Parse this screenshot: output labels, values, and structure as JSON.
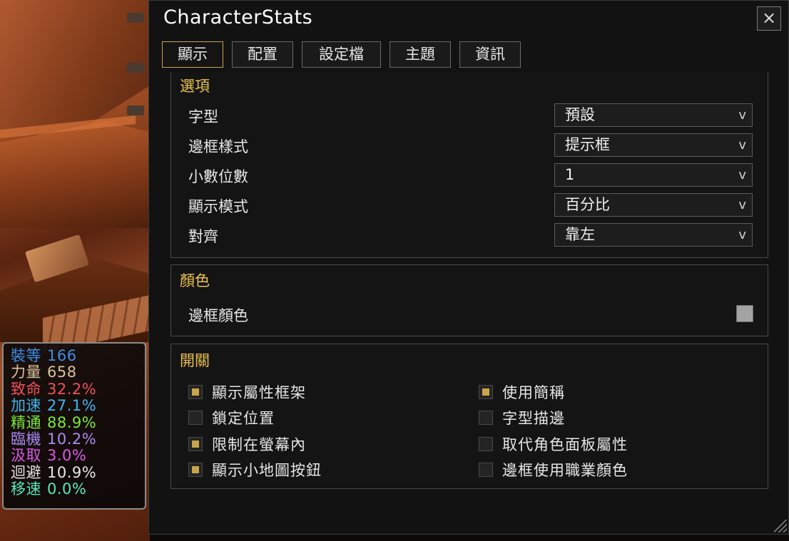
{
  "stats_overlay": [
    {
      "label": "裝等",
      "value": "166",
      "color": "#3a8ee8"
    },
    {
      "label": "力量",
      "value": "658",
      "color": "#d9c39a"
    },
    {
      "label": "致命",
      "value": "32.2%",
      "color": "#f0505a"
    },
    {
      "label": "加速",
      "value": "27.1%",
      "color": "#3ab8f0"
    },
    {
      "label": "精通",
      "value": "88.9%",
      "color": "#7ae83a"
    },
    {
      "label": "臨機",
      "value": "10.2%",
      "color": "#a88af0"
    },
    {
      "label": "汲取",
      "value": "3.0%",
      "color": "#d85ae8"
    },
    {
      "label": "迴避",
      "value": "10.9%",
      "color": "#e6e6e6"
    },
    {
      "label": "移速",
      "value": "0.0%",
      "color": "#5ae8b8"
    }
  ],
  "window": {
    "title": "CharacterStats",
    "close_label": "×",
    "tabs": [
      {
        "label": "顯示",
        "active": true
      },
      {
        "label": "配置",
        "active": false
      },
      {
        "label": "設定檔",
        "active": false
      },
      {
        "label": "主題",
        "active": false
      },
      {
        "label": "資訊",
        "active": false
      }
    ]
  },
  "options_section": {
    "title": "選項",
    "rows": [
      {
        "label": "字型",
        "value": "預設"
      },
      {
        "label": "邊框樣式",
        "value": "提示框"
      },
      {
        "label": "小數位數",
        "value": "1"
      },
      {
        "label": "顯示模式",
        "value": "百分比"
      },
      {
        "label": "對齊",
        "value": "靠左"
      }
    ],
    "dropdown_arrow": "v"
  },
  "color_section": {
    "title": "顏色",
    "border_color_label": "邊框顏色",
    "border_color": "#a3a3a3"
  },
  "toggles_section": {
    "title": "開關",
    "left": [
      {
        "label": "顯示屬性框架",
        "checked": true
      },
      {
        "label": "鎖定位置",
        "checked": false
      },
      {
        "label": "限制在螢幕內",
        "checked": true
      },
      {
        "label": "顯示小地圖按鈕",
        "checked": true
      }
    ],
    "right": [
      {
        "label": "使用簡稱",
        "checked": true
      },
      {
        "label": "字型描邊",
        "checked": false
      },
      {
        "label": "取代角色面板屬性",
        "checked": false
      },
      {
        "label": "邊框使用職業顏色",
        "checked": false
      }
    ]
  },
  "accent_color": "#c9a54a"
}
